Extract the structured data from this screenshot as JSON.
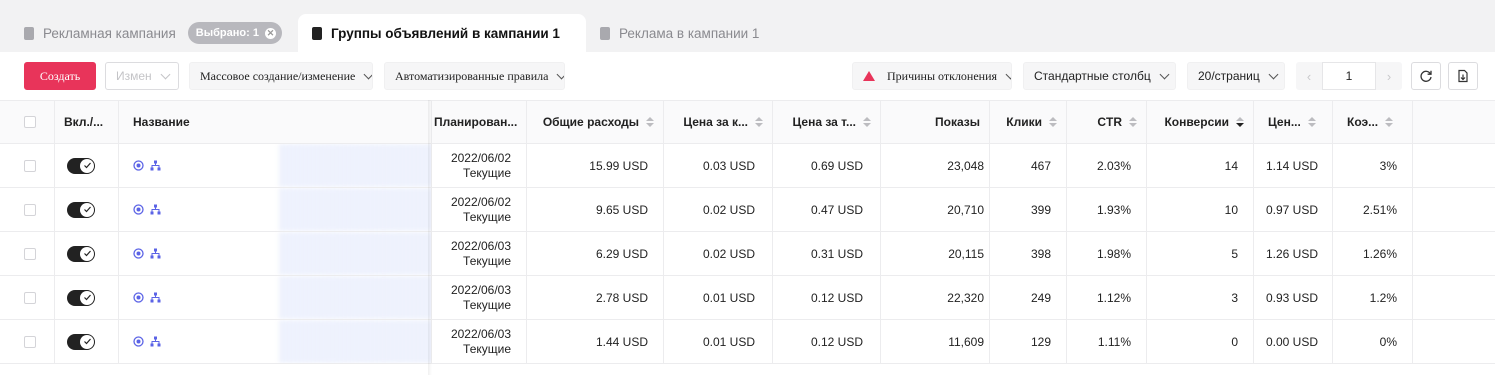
{
  "tabs": [
    {
      "label": "Рекламная кампания",
      "badge": "Выбрано: 1"
    },
    {
      "label": "Группы объявлений в кампании 1"
    },
    {
      "label": "Реклама в кампании 1"
    }
  ],
  "toolbar": {
    "create": "Создать",
    "edit": "Измен",
    "mass": "Массовое создание/изменение",
    "rules": "Автоматизированные правила",
    "reasons": "Причины отклонения",
    "columns": "Стандартные столбц",
    "per_page": "20/страниц",
    "page": "1",
    "prev": "‹",
    "next": "›"
  },
  "table": {
    "headers": {
      "toggle": "Вкл./...",
      "name": "Название",
      "planned": "Планирован...",
      "spend": "Общие расходы",
      "cpc": "Цена за к...",
      "cpm": "Цена за т...",
      "impressions": "Показы",
      "clicks": "Клики",
      "ctr": "CTR",
      "conversions": "Конверсии",
      "cpa": "Цен...",
      "cr": "Коэ..."
    },
    "rows": [
      {
        "date": "2022/06/02",
        "status": "Текущие",
        "spend": "15.99 USD",
        "cpc": "0.03 USD",
        "cpm": "0.69 USD",
        "impressions": "23,048",
        "clicks": "467",
        "ctr": "2.03%",
        "conversions": "14",
        "cpa": "1.14 USD",
        "cr": "3%"
      },
      {
        "date": "2022/06/02",
        "status": "Текущие",
        "spend": "9.65 USD",
        "cpc": "0.02 USD",
        "cpm": "0.47 USD",
        "impressions": "20,710",
        "clicks": "399",
        "ctr": "1.93%",
        "conversions": "10",
        "cpa": "0.97 USD",
        "cr": "2.51%"
      },
      {
        "date": "2022/06/03",
        "status": "Текущие",
        "spend": "6.29 USD",
        "cpc": "0.02 USD",
        "cpm": "0.31 USD",
        "impressions": "20,115",
        "clicks": "398",
        "ctr": "1.98%",
        "conversions": "5",
        "cpa": "1.26 USD",
        "cr": "1.26%"
      },
      {
        "date": "2022/06/03",
        "status": "Текущие",
        "spend": "2.78 USD",
        "cpc": "0.01 USD",
        "cpm": "0.12 USD",
        "impressions": "22,320",
        "clicks": "249",
        "ctr": "1.12%",
        "conversions": "3",
        "cpa": "0.93 USD",
        "cr": "1.2%"
      },
      {
        "date": "2022/06/03",
        "status": "Текущие",
        "spend": "1.44 USD",
        "cpc": "0.01 USD",
        "cpm": "0.12 USD",
        "impressions": "11,609",
        "clicks": "129",
        "ctr": "1.11%",
        "conversions": "0",
        "cpa": "0.00 USD",
        "cr": "0%"
      }
    ]
  },
  "icons": {
    "tab": "folder-icon",
    "warning": "warning-triangle-icon",
    "refresh": "refresh-icon",
    "export": "export-file-icon",
    "ad_group": "target-icon",
    "structure": "hierarchy-icon"
  },
  "colors": {
    "accent": "#e8345a",
    "icon_blue": "#5b63e6",
    "toggle_on": "#222222"
  }
}
